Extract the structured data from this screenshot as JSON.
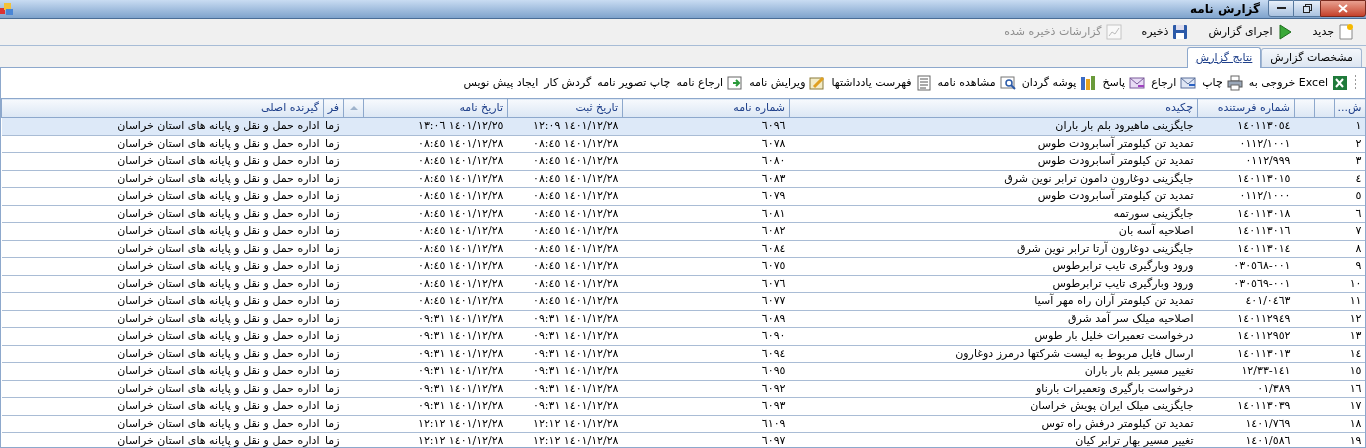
{
  "window": {
    "title": "گزارش نامه"
  },
  "toolbar": [
    {
      "label": "جدید",
      "disabled": false
    },
    {
      "label": "اجرای گزارش",
      "disabled": false
    },
    {
      "label": "ذخیره",
      "disabled": false
    },
    {
      "label": "گزارشات ذخیره شده",
      "disabled": true
    }
  ],
  "tabs": [
    {
      "label": "مشخصات گزارش",
      "selected": false
    },
    {
      "label": "نتایج گزارش",
      "selected": true
    }
  ],
  "actions": [
    {
      "label": "خروجی به Excel",
      "has_icon": true
    },
    {
      "label": "چاپ",
      "has_icon": true
    },
    {
      "label": "ارجاع",
      "has_icon": true
    },
    {
      "label": "پاسخ",
      "has_icon": true
    },
    {
      "label": "پوشه گردان",
      "has_icon": true
    },
    {
      "label": "مشاهده نامه",
      "has_icon": true
    },
    {
      "label": "فهرست یادداشتها",
      "has_icon": true
    },
    {
      "label": "ویرایش نامه",
      "has_icon": true
    },
    {
      "label": "ارجاع نامه",
      "has_icon": true
    },
    {
      "label": "چاپ تصویر نامه",
      "has_icon": false
    },
    {
      "label": "گردش کار",
      "has_icon": false
    },
    {
      "label": "ایجاد پیش نویس",
      "has_icon": false
    }
  ],
  "table": {
    "columns": [
      {
        "label": "ش..."
      },
      {
        "label": "شماره فرستنده"
      },
      {
        "label": "چکیده"
      },
      {
        "label": "شماره نامه"
      },
      {
        "label": "تاریخ ثبت"
      },
      {
        "label": "تاریخ نامه",
        "sorted": true
      },
      {
        "label": "فر"
      },
      {
        "label": "گیرنده اصلی"
      }
    ],
    "rows": [
      {
        "selected": true,
        "cells": [
          "١",
          "١٤٠١١٣٠٥٤",
          "جایگزینی ماهیرود بلم بار باران",
          "٦٠٩٦",
          "١٤٠١/١٢/٢٨ ١٢:٠٩",
          "١٤٠١/١٢/٢٥ ١٣:٠٦",
          "زما",
          "اداره حمل و نقل و پایانه های استان خراسان"
        ]
      },
      {
        "selected": false,
        "cells": [
          "٢",
          "٠١١٢/١٠٠١",
          "تمدید تن کیلومتر آسابرودت طوس",
          "٦٠٧٨",
          "١٤٠١/١٢/٢٨ ٠٨:٤٥",
          "١٤٠١/١٢/٢٨ ٠٨:٤٥",
          "زما",
          "اداره حمل و نقل و پایانه های استان خراسان"
        ]
      },
      {
        "selected": false,
        "cells": [
          "٣",
          "٠١١٢/٩٩٩",
          "تمدید تن کیلومتر آسابرودت طوس",
          "٦٠٨٠",
          "١٤٠١/١٢/٢٨ ٠٨:٤٥",
          "١٤٠١/١٢/٢٨ ٠٨:٤٥",
          "زما",
          "اداره حمل و نقل و پایانه های استان خراسان"
        ]
      },
      {
        "selected": false,
        "cells": [
          "٤",
          "١٤٠١١٣٠١٥",
          "جایگزینی دوغارون دامون ترابر نوین شرق",
          "٦٠٨٣",
          "١٤٠١/١٢/٢٨ ٠٨:٤٥",
          "١٤٠١/١٢/٢٨ ٠٨:٤٥",
          "زما",
          "اداره حمل و نقل و پایانه های استان خراسان"
        ]
      },
      {
        "selected": false,
        "cells": [
          "٥",
          "٠١١٢/١٠٠٠",
          "تمدید تن کیلومتر آسابرودت طوس",
          "٦٠٧٩",
          "١٤٠١/١٢/٢٨ ٠٨:٤٥",
          "١٤٠١/١٢/٢٨ ٠٨:٤٥",
          "زما",
          "اداره حمل و نقل و پایانه های استان خراسان"
        ]
      },
      {
        "selected": false,
        "cells": [
          "٦",
          "١٤٠١١٣٠١٨",
          "جایگزینی سورتمه",
          "٦٠٨١",
          "١٤٠١/١٢/٢٨ ٠٨:٤٥",
          "١٤٠١/١٢/٢٨ ٠٨:٤٥",
          "زما",
          "اداره حمل و نقل و پایانه های استان خراسان"
        ]
      },
      {
        "selected": false,
        "cells": [
          "٧",
          "١٤٠١١٣٠١٦",
          "اصلاحیه آسه بان",
          "٦٠٨٢",
          "١٤٠١/١٢/٢٨ ٠٨:٤٥",
          "١٤٠١/١٢/٢٨ ٠٨:٤٥",
          "زما",
          "اداره حمل و نقل و پایانه های استان خراسان"
        ]
      },
      {
        "selected": false,
        "cells": [
          "٨",
          "١٤٠١١٣٠١٤",
          "جایگزینی دوغارون آرتا ترابر نوین شرق",
          "٦٠٨٤",
          "١٤٠١/١٢/٢٨ ٠٨:٤٥",
          "١٤٠١/١٢/٢٨ ٠٨:٤٥",
          "زما",
          "اداره حمل و نقل و پایانه های استان خراسان"
        ]
      },
      {
        "selected": false,
        "cells": [
          "٩",
          "٠٣٠٥٦٨-٠٠١",
          "ورود وبارگیری تایب ترابرطوس",
          "٦٠٧٥",
          "١٤٠١/١٢/٢٨ ٠٨:٤٥",
          "١٤٠١/١٢/٢٨ ٠٨:٤٥",
          "زما",
          "اداره حمل و نقل و پایانه های استان خراسان"
        ]
      },
      {
        "selected": false,
        "cells": [
          "١٠",
          "٠٣٠٥٦٩-٠٠١",
          "ورود وبارگیری تایب ترابرطوس",
          "٦٠٧٦",
          "١٤٠١/١٢/٢٨ ٠٨:٤٥",
          "١٤٠١/١٢/٢٨ ٠٨:٤٥",
          "زما",
          "اداره حمل و نقل و پایانه های استان خراسان"
        ]
      },
      {
        "selected": false,
        "cells": [
          "١١",
          "٤٠١/٠٤٦٣",
          "تمدید تن کیلومتر آران راه مهر آسیا",
          "٦٠٧٧",
          "١٤٠١/١٢/٢٨ ٠٨:٤٥",
          "١٤٠١/١٢/٢٨ ٠٨:٤٥",
          "زما",
          "اداره حمل و نقل و پایانه های استان خراسان"
        ]
      },
      {
        "selected": false,
        "cells": [
          "١٢",
          "١٤٠١١٢٩٤٩",
          "اصلاحیه میلک سر آمد شرق",
          "٦٠٨٩",
          "١٤٠١/١٢/٢٨ ٠٩:٣١",
          "١٤٠١/١٢/٢٨ ٠٩:٣١",
          "زما",
          "اداره حمل و نقل و پایانه های استان خراسان"
        ]
      },
      {
        "selected": false,
        "cells": [
          "١٣",
          "١٤٠١١٢٩٥٢",
          "درخواست تعمیرات خلیل بار طوس",
          "٦٠٩٠",
          "١٤٠١/١٢/٢٨ ٠٩:٣١",
          "١٤٠١/١٢/٢٨ ٠٩:٣١",
          "زما",
          "اداره حمل و نقل و پایانه های استان خراسان"
        ]
      },
      {
        "selected": false,
        "cells": [
          "١٤",
          "١٤٠١١٣٠١٣",
          "ارسال فایل مربوط به لیست شرکتها درمرز دوغارون",
          "٦٠٩٤",
          "١٤٠١/١٢/٢٨ ٠٩:٣١",
          "١٤٠١/١٢/٢٨ ٠٩:٣١",
          "زما",
          "اداره حمل و نقل و پایانه های استان خراسان"
        ]
      },
      {
        "selected": false,
        "cells": [
          "١٥",
          "١٢/٣٣-١٤١",
          "تغییر مسیر بلم بار باران",
          "٦٠٩٥",
          "١٤٠١/١٢/٢٨ ٠٩:٣١",
          "١٤٠١/١٢/٢٨ ٠٩:٣١",
          "زما",
          "اداره حمل و نقل و پایانه های استان خراسان"
        ]
      },
      {
        "selected": false,
        "cells": [
          "١٦",
          "٠١/٣٨٩",
          "درخواست بارگیری وتعمیرات بارناو",
          "٦٠٩٢",
          "١٤٠١/١٢/٢٨ ٠٩:٣١",
          "١٤٠١/١٢/٢٨ ٠٩:٣١",
          "زما",
          "اداره حمل و نقل و پایانه های استان خراسان"
        ]
      },
      {
        "selected": false,
        "cells": [
          "١٧",
          "١٤٠١١٣٠٣٩",
          "جایگزینی میلک ایران پویش خراسان",
          "٦٠٩٣",
          "١٤٠١/١٢/٢٨ ٠٩:٣١",
          "١٤٠١/١٢/٢٨ ٠٩:٣١",
          "زما",
          "اداره حمل و نقل و پایانه های استان خراسان"
        ]
      },
      {
        "selected": false,
        "cells": [
          "١٨",
          "١٤٠١/٧٦٩",
          "تمدید تن کیلومتر درفش راه توس",
          "٦١٠٩",
          "١٤٠١/١٢/٢٨ ١٢:١٢",
          "١٤٠١/١٢/٢٨ ١٢:١٢",
          "زما",
          "اداره حمل و نقل و پایانه های استان خراسان"
        ]
      },
      {
        "selected": false,
        "cells": [
          "١٩",
          "١٤٠١/٥٨٦",
          "تغییر مسیر بهار ترابر کیان",
          "٦٠٩٧",
          "١٤٠١/١٢/٢٨ ١٢:١٢",
          "١٤٠١/١٢/٢٨ ١٢:١٢",
          "زما",
          "اداره حمل و نقل و پایانه های استان خراسان"
        ]
      }
    ]
  }
}
